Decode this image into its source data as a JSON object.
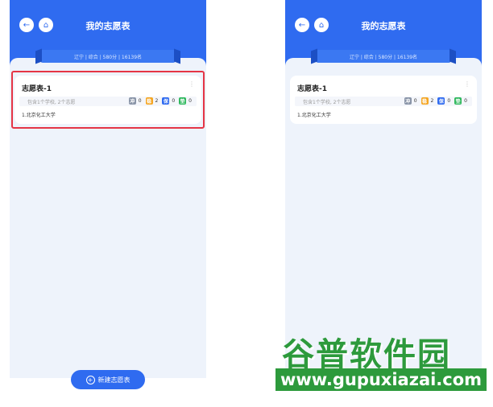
{
  "header": {
    "title": "我的志愿表",
    "back_icon": "arrow-left-icon",
    "home_icon": "home-icon"
  },
  "ribbon": {
    "text": "辽宁 | 综合 | 580分 | 16139名"
  },
  "card": {
    "title": "志愿表-1",
    "more_icon": "more-dots-icon",
    "subtitle": "包含1个学校, 2个志愿",
    "badges": [
      {
        "label": "冲",
        "count": "0",
        "color": "#8a95a8"
      },
      {
        "label": "稳",
        "count": "2",
        "color": "#f5a623"
      },
      {
        "label": "保",
        "count": "0",
        "color": "#2f6bf0"
      },
      {
        "label": "垫",
        "count": "0",
        "color": "#2eb85c"
      }
    ],
    "school": "1.北京化工大学"
  },
  "actions": {
    "new_button": "新建志愿表"
  },
  "watermark": {
    "brand": "谷普软件园",
    "url": "www.gupuxiazai.com"
  },
  "colors": {
    "primary": "#2f6bf0",
    "highlight": "#e53545"
  }
}
